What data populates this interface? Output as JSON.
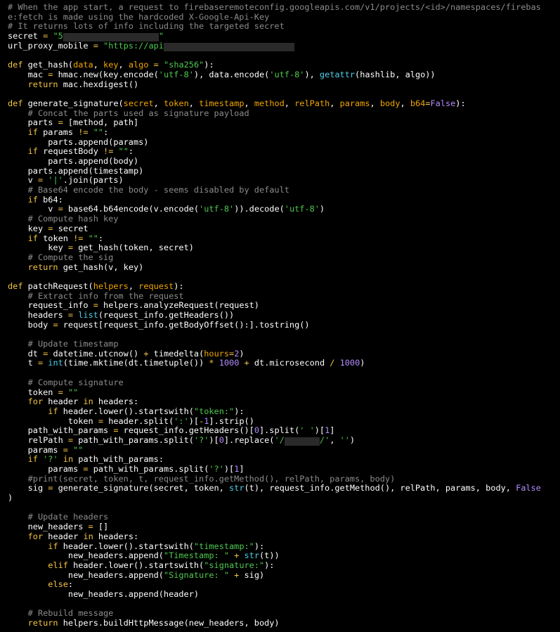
{
  "language": "python",
  "theme": {
    "background": "#000000",
    "default": "#ffffff",
    "comment": "#8c8c8c",
    "keyword": "#f4c542",
    "string": "#4ec94e",
    "number": "#b48cff",
    "param": "#f0a500",
    "builtin": "#4fd1e8",
    "redaction": "#2f2f2f"
  },
  "lines": [
    [
      [
        "comment",
        "# When the app start, a request to firebaseremoteconfig.googleapis.com/v1/projects/<id>/namespaces/firebas"
      ]
    ],
    [
      [
        "comment",
        "e:fetch is made using the hardcoded X-Google-Api-Key"
      ]
    ],
    [
      [
        "comment",
        "# It returns lots of info including the targeted secret"
      ]
    ],
    [
      [
        "default",
        "secret "
      ],
      [
        "keyword",
        "="
      ],
      [
        "default",
        " "
      ],
      [
        "string",
        "\"5"
      ],
      [
        "redact",
        "                   "
      ],
      [
        "string",
        "\""
      ]
    ],
    [
      [
        "default",
        "url_proxy_mobile "
      ],
      [
        "keyword",
        "="
      ],
      [
        "default",
        " "
      ],
      [
        "string",
        "\"https://api"
      ],
      [
        "redact",
        "                          "
      ]
    ],
    [
      [
        "default",
        ""
      ]
    ],
    [
      [
        "keyword",
        "def"
      ],
      [
        "default",
        " get_hash("
      ],
      [
        "param",
        "data"
      ],
      [
        "default",
        ", "
      ],
      [
        "param",
        "key"
      ],
      [
        "default",
        ", "
      ],
      [
        "param",
        "algo"
      ],
      [
        "default",
        " "
      ],
      [
        "keyword",
        "="
      ],
      [
        "default",
        " "
      ],
      [
        "string",
        "\"sha256\""
      ],
      [
        "default",
        "):"
      ]
    ],
    [
      [
        "default",
        "    mac "
      ],
      [
        "keyword",
        "="
      ],
      [
        "default",
        " hmac.new(key.encode("
      ],
      [
        "string",
        "'utf-8'"
      ],
      [
        "default",
        "), data.encode("
      ],
      [
        "string",
        "'utf-8'"
      ],
      [
        "default",
        "), "
      ],
      [
        "builtin",
        "getattr"
      ],
      [
        "default",
        "(hashlib, algo))"
      ]
    ],
    [
      [
        "default",
        "    "
      ],
      [
        "keyword",
        "return"
      ],
      [
        "default",
        " mac.hexdigest()"
      ]
    ],
    [
      [
        "default",
        ""
      ]
    ],
    [
      [
        "keyword",
        "def"
      ],
      [
        "default",
        " generate_signature("
      ],
      [
        "param",
        "secret"
      ],
      [
        "default",
        ", "
      ],
      [
        "param",
        "token"
      ],
      [
        "default",
        ", "
      ],
      [
        "param",
        "timestamp"
      ],
      [
        "default",
        ", "
      ],
      [
        "param",
        "method"
      ],
      [
        "default",
        ", "
      ],
      [
        "param",
        "relPath"
      ],
      [
        "default",
        ", "
      ],
      [
        "param",
        "params"
      ],
      [
        "default",
        ", "
      ],
      [
        "param",
        "body"
      ],
      [
        "default",
        ", "
      ],
      [
        "param",
        "b64"
      ],
      [
        "keyword",
        "="
      ],
      [
        "number",
        "False"
      ],
      [
        "default",
        "):"
      ]
    ],
    [
      [
        "default",
        "    "
      ],
      [
        "comment",
        "# Concat the parts used as signature payload"
      ]
    ],
    [
      [
        "default",
        "    parts "
      ],
      [
        "keyword",
        "="
      ],
      [
        "default",
        " [method, path]"
      ]
    ],
    [
      [
        "default",
        "    "
      ],
      [
        "keyword",
        "if"
      ],
      [
        "default",
        " params "
      ],
      [
        "keyword",
        "!="
      ],
      [
        "default",
        " "
      ],
      [
        "string",
        "\"\""
      ],
      [
        "default",
        ":"
      ]
    ],
    [
      [
        "default",
        "        parts.append(params)"
      ]
    ],
    [
      [
        "default",
        "    "
      ],
      [
        "keyword",
        "if"
      ],
      [
        "default",
        " requestBody "
      ],
      [
        "keyword",
        "!="
      ],
      [
        "default",
        " "
      ],
      [
        "string",
        "\"\""
      ],
      [
        "default",
        ":"
      ]
    ],
    [
      [
        "default",
        "        parts.append(body)"
      ]
    ],
    [
      [
        "default",
        "    parts.append(timestamp)"
      ]
    ],
    [
      [
        "default",
        "    v "
      ],
      [
        "keyword",
        "="
      ],
      [
        "default",
        " "
      ],
      [
        "string",
        "'|'"
      ],
      [
        "default",
        ".join(parts)"
      ]
    ],
    [
      [
        "default",
        "    "
      ],
      [
        "comment",
        "# Base64 encode the body - seems disabled by default"
      ]
    ],
    [
      [
        "default",
        "    "
      ],
      [
        "keyword",
        "if"
      ],
      [
        "default",
        " b64:"
      ]
    ],
    [
      [
        "default",
        "        v "
      ],
      [
        "keyword",
        "="
      ],
      [
        "default",
        " base64.b64encode(v.encode("
      ],
      [
        "string",
        "'utf-8'"
      ],
      [
        "default",
        ")).decode("
      ],
      [
        "string",
        "'utf-8'"
      ],
      [
        "default",
        ")"
      ]
    ],
    [
      [
        "default",
        "    "
      ],
      [
        "comment",
        "# Compute hash key"
      ]
    ],
    [
      [
        "default",
        "    key "
      ],
      [
        "keyword",
        "="
      ],
      [
        "default",
        " secret"
      ]
    ],
    [
      [
        "default",
        "    "
      ],
      [
        "keyword",
        "if"
      ],
      [
        "default",
        " token "
      ],
      [
        "keyword",
        "!="
      ],
      [
        "default",
        " "
      ],
      [
        "string",
        "\"\""
      ],
      [
        "default",
        ":"
      ]
    ],
    [
      [
        "default",
        "        key "
      ],
      [
        "keyword",
        "="
      ],
      [
        "default",
        " get_hash(token, secret)"
      ]
    ],
    [
      [
        "default",
        "    "
      ],
      [
        "comment",
        "# Compute the sig"
      ]
    ],
    [
      [
        "default",
        "    "
      ],
      [
        "keyword",
        "return"
      ],
      [
        "default",
        " get_hash(v, key)"
      ]
    ],
    [
      [
        "default",
        ""
      ]
    ],
    [
      [
        "keyword",
        "def"
      ],
      [
        "default",
        " patchRequest("
      ],
      [
        "param",
        "helpers"
      ],
      [
        "default",
        ", "
      ],
      [
        "param",
        "request"
      ],
      [
        "default",
        "):"
      ]
    ],
    [
      [
        "default",
        "    "
      ],
      [
        "comment",
        "# Extract info from the request"
      ]
    ],
    [
      [
        "default",
        "    request_info "
      ],
      [
        "keyword",
        "="
      ],
      [
        "default",
        " helpers.analyzeRequest(request)"
      ]
    ],
    [
      [
        "default",
        "    headers "
      ],
      [
        "keyword",
        "="
      ],
      [
        "default",
        " "
      ],
      [
        "builtin",
        "list"
      ],
      [
        "default",
        "(request_info.getHeaders())"
      ]
    ],
    [
      [
        "default",
        "    body "
      ],
      [
        "keyword",
        "="
      ],
      [
        "default",
        " request[request_info.getBodyOffset():].tostring()"
      ]
    ],
    [
      [
        "default",
        ""
      ]
    ],
    [
      [
        "default",
        "    "
      ],
      [
        "comment",
        "# Update timestamp"
      ]
    ],
    [
      [
        "default",
        "    dt "
      ],
      [
        "keyword",
        "="
      ],
      [
        "default",
        " datetime.utcnow() "
      ],
      [
        "keyword",
        "+"
      ],
      [
        "default",
        " timedelta("
      ],
      [
        "param",
        "hours"
      ],
      [
        "keyword",
        "="
      ],
      [
        "number",
        "2"
      ],
      [
        "default",
        ")"
      ]
    ],
    [
      [
        "default",
        "    t "
      ],
      [
        "keyword",
        "="
      ],
      [
        "default",
        " "
      ],
      [
        "builtin",
        "int"
      ],
      [
        "default",
        "(time.mktime(dt.timetuple()) "
      ],
      [
        "keyword",
        "*"
      ],
      [
        "default",
        " "
      ],
      [
        "number",
        "1000"
      ],
      [
        "default",
        " "
      ],
      [
        "keyword",
        "+"
      ],
      [
        "default",
        " dt.microsecond "
      ],
      [
        "keyword",
        "/"
      ],
      [
        "default",
        " "
      ],
      [
        "number",
        "1000"
      ],
      [
        "default",
        ")"
      ]
    ],
    [
      [
        "default",
        ""
      ]
    ],
    [
      [
        "default",
        "    "
      ],
      [
        "comment",
        "# Compute signature"
      ]
    ],
    [
      [
        "default",
        "    token "
      ],
      [
        "keyword",
        "="
      ],
      [
        "default",
        " "
      ],
      [
        "string",
        "\"\""
      ]
    ],
    [
      [
        "default",
        "    "
      ],
      [
        "keyword",
        "for"
      ],
      [
        "default",
        " header "
      ],
      [
        "keyword",
        "in"
      ],
      [
        "default",
        " headers:"
      ]
    ],
    [
      [
        "default",
        "        "
      ],
      [
        "keyword",
        "if"
      ],
      [
        "default",
        " header.lower().startswith("
      ],
      [
        "string",
        "\"token:\""
      ],
      [
        "default",
        "):"
      ]
    ],
    [
      [
        "default",
        "            token "
      ],
      [
        "keyword",
        "="
      ],
      [
        "default",
        " header.split("
      ],
      [
        "string",
        "':'"
      ],
      [
        "default",
        ")["
      ],
      [
        "keyword",
        "-"
      ],
      [
        "number",
        "1"
      ],
      [
        "default",
        "].strip()"
      ]
    ],
    [
      [
        "default",
        "    path_with_params "
      ],
      [
        "keyword",
        "="
      ],
      [
        "default",
        " request_info.getHeaders()["
      ],
      [
        "number",
        "0"
      ],
      [
        "default",
        "].split("
      ],
      [
        "string",
        "' '"
      ],
      [
        "default",
        ")["
      ],
      [
        "number",
        "1"
      ],
      [
        "default",
        "]"
      ]
    ],
    [
      [
        "default",
        "    relPath "
      ],
      [
        "keyword",
        "="
      ],
      [
        "default",
        " path_with_params.split("
      ],
      [
        "string",
        "'?'"
      ],
      [
        "default",
        ")["
      ],
      [
        "number",
        "0"
      ],
      [
        "default",
        "].replace("
      ],
      [
        "string",
        "'/"
      ],
      [
        "redact",
        "       "
      ],
      [
        "string",
        "/'"
      ],
      [
        "default",
        ", "
      ],
      [
        "string",
        "''"
      ],
      [
        "default",
        ")"
      ]
    ],
    [
      [
        "default",
        "    params "
      ],
      [
        "keyword",
        "="
      ],
      [
        "default",
        " "
      ],
      [
        "string",
        "\"\""
      ]
    ],
    [
      [
        "default",
        "    "
      ],
      [
        "keyword",
        "if"
      ],
      [
        "default",
        " "
      ],
      [
        "string",
        "'?'"
      ],
      [
        "default",
        " "
      ],
      [
        "keyword",
        "in"
      ],
      [
        "default",
        " path_with_params:"
      ]
    ],
    [
      [
        "default",
        "        params "
      ],
      [
        "keyword",
        "="
      ],
      [
        "default",
        " path_with_params.split("
      ],
      [
        "string",
        "'?'"
      ],
      [
        "default",
        ")["
      ],
      [
        "number",
        "1"
      ],
      [
        "default",
        "]"
      ]
    ],
    [
      [
        "default",
        "    "
      ],
      [
        "comment",
        "#print(secret, token, t, request_info.getMethod(), relPath, params, body)"
      ]
    ],
    [
      [
        "default",
        "    sig "
      ],
      [
        "keyword",
        "="
      ],
      [
        "default",
        " generate_signature(secret, token, "
      ],
      [
        "builtin",
        "str"
      ],
      [
        "default",
        "(t), request_info.getMethod(), relPath, params, body, "
      ],
      [
        "number",
        "False"
      ]
    ],
    [
      [
        "default",
        ")"
      ]
    ],
    [
      [
        "default",
        ""
      ]
    ],
    [
      [
        "default",
        "    "
      ],
      [
        "comment",
        "# Update headers"
      ]
    ],
    [
      [
        "default",
        "    new_headers "
      ],
      [
        "keyword",
        "="
      ],
      [
        "default",
        " []"
      ]
    ],
    [
      [
        "default",
        "    "
      ],
      [
        "keyword",
        "for"
      ],
      [
        "default",
        " header "
      ],
      [
        "keyword",
        "in"
      ],
      [
        "default",
        " headers:"
      ]
    ],
    [
      [
        "default",
        "        "
      ],
      [
        "keyword",
        "if"
      ],
      [
        "default",
        " header.lower().startswith("
      ],
      [
        "string",
        "\"timestamp:\""
      ],
      [
        "default",
        "):"
      ]
    ],
    [
      [
        "default",
        "            new_headers.append("
      ],
      [
        "string",
        "\"Timestamp: \""
      ],
      [
        "default",
        " "
      ],
      [
        "keyword",
        "+"
      ],
      [
        "default",
        " "
      ],
      [
        "builtin",
        "str"
      ],
      [
        "default",
        "(t))"
      ]
    ],
    [
      [
        "default",
        "        "
      ],
      [
        "keyword",
        "elif"
      ],
      [
        "default",
        " header.lower().startswith("
      ],
      [
        "string",
        "\"signature:\""
      ],
      [
        "default",
        "):"
      ]
    ],
    [
      [
        "default",
        "            new_headers.append("
      ],
      [
        "string",
        "\"Signature: \""
      ],
      [
        "default",
        " "
      ],
      [
        "keyword",
        "+"
      ],
      [
        "default",
        " sig)"
      ]
    ],
    [
      [
        "default",
        "        "
      ],
      [
        "keyword",
        "else"
      ],
      [
        "default",
        ":"
      ]
    ],
    [
      [
        "default",
        "            new_headers.append(header)"
      ]
    ],
    [
      [
        "default",
        ""
      ]
    ],
    [
      [
        "default",
        "    "
      ],
      [
        "comment",
        "# Rebuild message"
      ]
    ],
    [
      [
        "default",
        "    "
      ],
      [
        "keyword",
        "return"
      ],
      [
        "default",
        " helpers.buildHttpMessage(new_headers, body)"
      ]
    ]
  ]
}
